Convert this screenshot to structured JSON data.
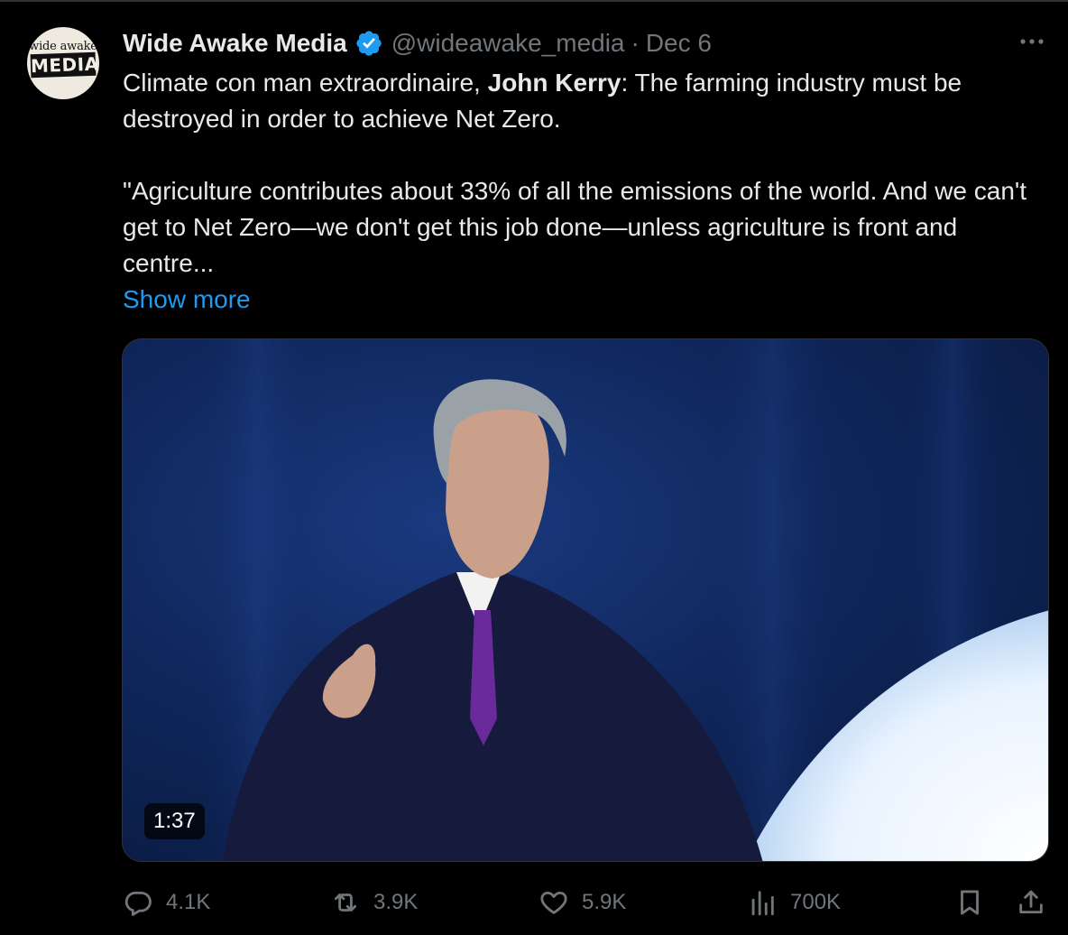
{
  "tweet": {
    "avatar": {
      "line1": "wide awake",
      "line2": "MEDIA"
    },
    "display_name": "Wide Awake Media",
    "handle": "@wideawake_media",
    "separator": "·",
    "date": "Dec 6",
    "text_intro": "Climate con man extraordinaire, ",
    "text_bold": "John Kerry",
    "text_after_bold": ": The farming industry must be destroyed in order to achieve Net Zero.",
    "quote": "\"Agriculture contributes about 33% of all the emissions of the world. And we can't get to Net Zero—we don't get this job done—unless agriculture is front and centre...",
    "show_more": "Show more",
    "video": {
      "duration": "1:37"
    }
  },
  "actions": {
    "replies": "4.1K",
    "retweets": "3.9K",
    "likes": "5.9K",
    "views": "700K"
  },
  "colors": {
    "background": "#000000",
    "text": "#e7e9ea",
    "muted": "#71767b",
    "link": "#1d9bf0",
    "verified": "#1d9bf0"
  }
}
